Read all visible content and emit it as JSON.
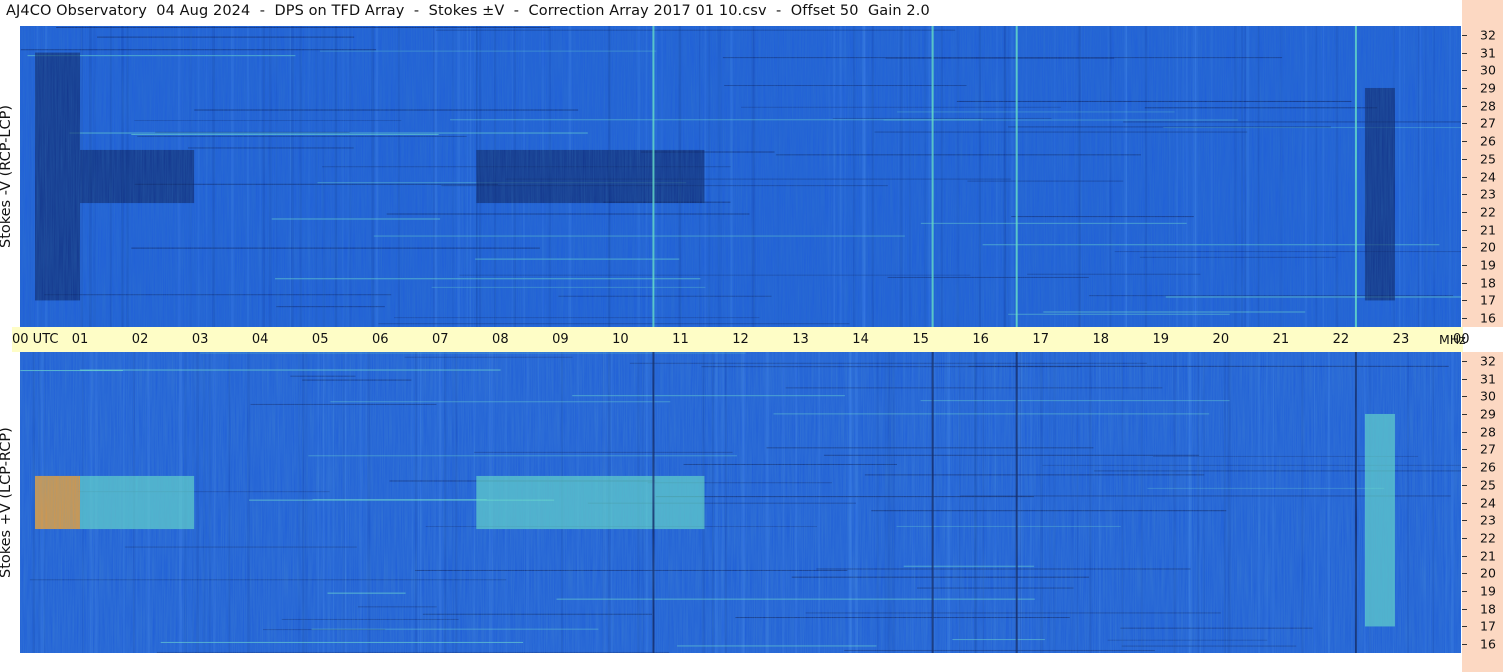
{
  "title": "AJ4CO Observatory  04 Aug 2024  -  DPS on TFD Array  -  Stokes ±V  -  Correction Array 2017 01 10.csv  -  Offset 50  Gain 2.0",
  "panels": {
    "top_label": "Stokes -V  (RCP-LCP)",
    "bottom_label": "Stokes +V  (LCP-RCP)"
  },
  "time_axis": {
    "labels": [
      "00 UTC",
      "01",
      "02",
      "03",
      "04",
      "05",
      "06",
      "07",
      "08",
      "09",
      "10",
      "11",
      "12",
      "13",
      "14",
      "15",
      "16",
      "17",
      "18",
      "19",
      "20",
      "21",
      "22",
      "23",
      "00"
    ],
    "unit": "MHz"
  },
  "freq_axis": {
    "labels": [
      "32",
      "31",
      "30",
      "29",
      "28",
      "27",
      "26",
      "25",
      "24",
      "23",
      "22",
      "21",
      "20",
      "19",
      "18",
      "17",
      "16"
    ]
  },
  "colors": {
    "background_blue": "#1f5ed8",
    "dark": "#0a1a5a",
    "bright": "#6ff0c8",
    "time_bar": "#fefdc6",
    "freq_bar": "#fcd8c2"
  },
  "chart_data": [
    {
      "type": "heatmap",
      "title": "Stokes -V  (RCP-LCP)",
      "xlabel": "UTC",
      "ylabel": "MHz",
      "xlim": [
        0,
        24
      ],
      "ylim": [
        16,
        32
      ],
      "regions": [
        {
          "t0": 0.25,
          "t1": 1.0,
          "f0": 17,
          "f1": 31,
          "level": "dark"
        },
        {
          "t0": 1.0,
          "t1": 2.9,
          "f0": 22.5,
          "f1": 25.5,
          "level": "dark"
        },
        {
          "t0": 7.6,
          "t1": 11.4,
          "f0": 22.5,
          "f1": 25.5,
          "level": "dark"
        },
        {
          "t0": 22.4,
          "t1": 22.9,
          "f0": 17,
          "f1": 29,
          "level": "dark"
        }
      ],
      "lines": [
        {
          "t": 10.55,
          "level": "bright"
        },
        {
          "t": 15.2,
          "level": "bright"
        },
        {
          "t": 16.6,
          "level": "bright"
        },
        {
          "t": 22.25,
          "level": "bright"
        }
      ]
    },
    {
      "type": "heatmap",
      "title": "Stokes +V  (LCP-RCP)",
      "xlabel": "UTC",
      "ylabel": "MHz",
      "xlim": [
        0,
        24
      ],
      "ylim": [
        16,
        32
      ],
      "regions": [
        {
          "t0": 0.25,
          "t1": 1.0,
          "f0": 22.5,
          "f1": 25.5,
          "level": "hot"
        },
        {
          "t0": 1.0,
          "t1": 2.9,
          "f0": 22.5,
          "f1": 25.5,
          "level": "bright"
        },
        {
          "t0": 7.6,
          "t1": 11.4,
          "f0": 22.5,
          "f1": 25.5,
          "level": "bright"
        },
        {
          "t0": 22.4,
          "t1": 22.9,
          "f0": 17,
          "f1": 29,
          "level": "bright"
        }
      ],
      "lines": [
        {
          "t": 10.55,
          "level": "dark"
        },
        {
          "t": 15.2,
          "level": "dark"
        },
        {
          "t": 16.6,
          "level": "dark"
        },
        {
          "t": 22.25,
          "level": "dark"
        }
      ]
    }
  ]
}
